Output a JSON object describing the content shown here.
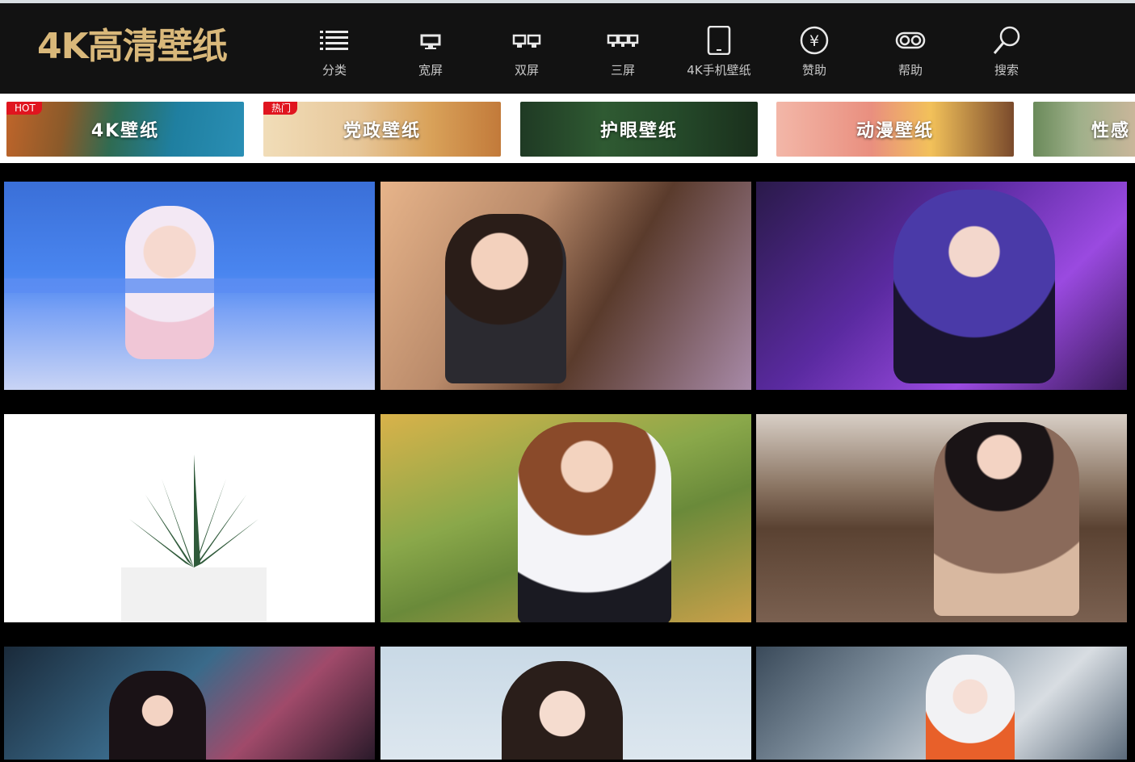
{
  "header": {
    "logo_text": "4K高清壁纸",
    "nav": [
      {
        "label": "分类",
        "icon": "list-icon"
      },
      {
        "label": "宽屏",
        "icon": "monitor-icon"
      },
      {
        "label": "双屏",
        "icon": "dual-monitor-icon"
      },
      {
        "label": "三屏",
        "icon": "triple-monitor-icon"
      },
      {
        "label": "4K手机壁纸",
        "icon": "phone-icon"
      },
      {
        "label": "赞助",
        "icon": "yen-coin-icon"
      },
      {
        "label": "帮助",
        "icon": "help-icon"
      },
      {
        "label": "搜索",
        "icon": "search-icon"
      }
    ]
  },
  "categories": [
    {
      "label": "4K壁纸",
      "badge": "HOT"
    },
    {
      "label": "党政壁纸",
      "badge": "热门"
    },
    {
      "label": "护眼壁纸",
      "badge": ""
    },
    {
      "label": "动漫壁纸",
      "badge": ""
    },
    {
      "label": "性感",
      "badge": ""
    }
  ],
  "colors": {
    "header_bg": "#121212",
    "logo_gold": "#d9b87a",
    "badge_red": "#e0151f"
  }
}
